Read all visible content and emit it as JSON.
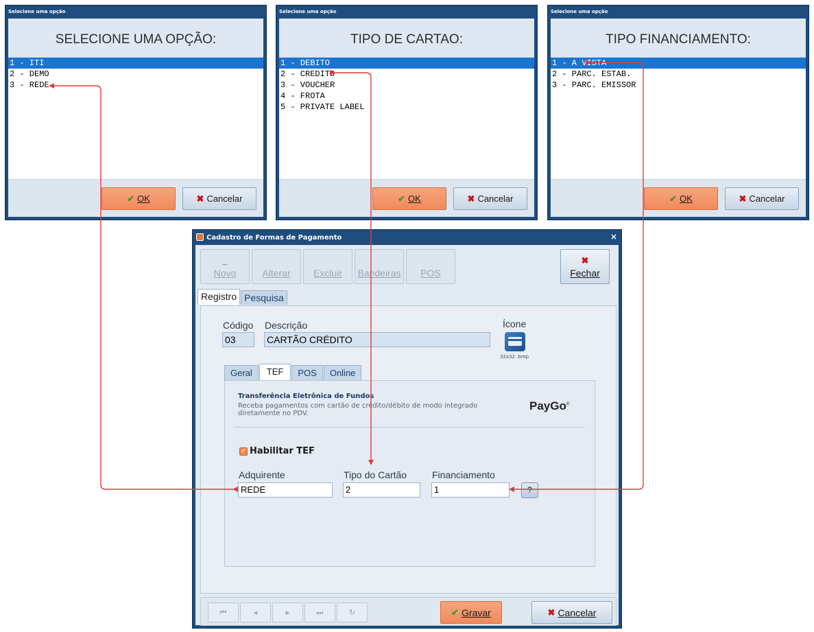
{
  "dialogs": [
    {
      "title": "Selecione uma opção",
      "heading": "SELECIONE UMA OPÇÃO:",
      "items": [
        "1 - ITI",
        "2 - DEMO",
        "3 - REDE"
      ],
      "selected_index": 0,
      "ok_label": "OK",
      "cancel_label": "Cancelar"
    },
    {
      "title": "Selecione uma opção",
      "heading": "TIPO DE CARTAO:",
      "items": [
        "1 - DEBITO",
        "2 - CREDITO",
        "3 - VOUCHER",
        "4 - FROTA",
        "5 - PRIVATE LABEL"
      ],
      "selected_index": 0,
      "ok_label": "OK",
      "cancel_label": "Cancelar"
    },
    {
      "title": "Selecione uma opção",
      "heading": "TIPO FINANCIAMENTO:",
      "items": [
        "1 - A VISTA",
        "2 - PARC. ESTAB.",
        "3 - PARC. EMISSOR"
      ],
      "selected_index": 0,
      "ok_label": "OK",
      "cancel_label": "Cancelar"
    }
  ],
  "main": {
    "title": "Cadastro de Formas de Pagamento",
    "toolbar": {
      "novo": "Novo",
      "alterar": "Alterar",
      "excluir": "Excluir",
      "bandeiras": "Bandeiras",
      "pos": "POS",
      "fechar": "Fechar"
    },
    "tabs": [
      "Registro",
      "Pesquisa"
    ],
    "codigo_label": "Código",
    "codigo_value": "03",
    "descricao_label": "Descrição",
    "descricao_value": "CARTÃO CRÉDITO",
    "icone_label": "Ícone",
    "icone_size": "32x32 .bmp",
    "subtabs": [
      "Geral",
      "TEF",
      "POS",
      "Online"
    ],
    "tef": {
      "title": "Transferência Eletrônica de Fundos",
      "description": "Receba pagamentos com cartão de crédito/débito de modo integrado diretamente no PDV.",
      "brand": "PayGo",
      "brand_mark": "®",
      "habilitar_label": "Habilitar TEF",
      "habilitar_checked": true,
      "adquirente_label": "Adquirente",
      "adquirente_value": "REDE",
      "tipo_cartao_label": "Tipo do Cartão",
      "tipo_cartao_value": "2",
      "financiamento_label": "Financiamento",
      "financiamento_value": "1",
      "help_label": "?"
    },
    "buttons": {
      "gravar": "Gravar",
      "cancelar": "Cancelar"
    }
  },
  "colors": {
    "window_frame": "#1e4d7e",
    "selection": "#1a75d2",
    "ok_button": "#f08a5c",
    "arrow": "#e03a3a"
  }
}
